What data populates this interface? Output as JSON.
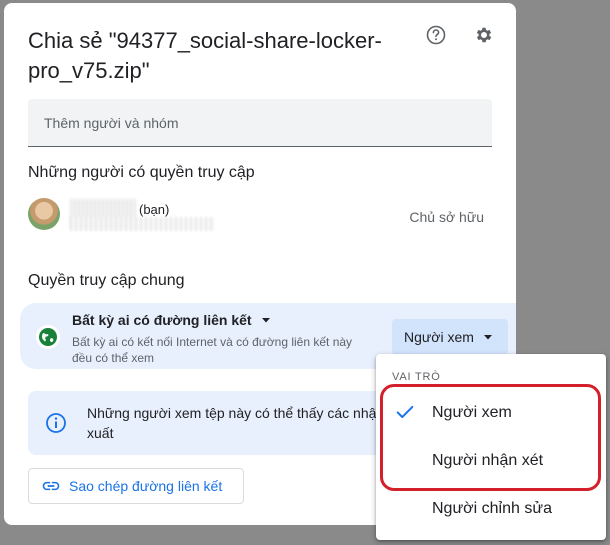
{
  "dialog": {
    "title": "Chia sẻ \"94377_social-share-locker-pro_v75.zip\"",
    "help_icon": "help-circle-icon",
    "settings_icon": "gear-icon"
  },
  "add_people": {
    "placeholder": "Thêm người và nhóm"
  },
  "people_section": {
    "title": "Những người có quyền truy cập",
    "person": {
      "you_label": "(bạn)",
      "role": "Chủ sở hữu"
    }
  },
  "general_access": {
    "title": "Quyền truy cập chung",
    "type_label": "Bất kỳ ai có đường liên kết",
    "description": "Bất kỳ ai có kết nối Internet và có đường liên kết này đều có thể xem",
    "role_button": "Người xem"
  },
  "info": {
    "text": "Những người xem tệp này có thể thấy các nhận xét và mục đề xuất"
  },
  "copy_link": {
    "label": "Sao chép đường liên kết"
  },
  "role_menu": {
    "header": "VAI TRÒ",
    "items": [
      {
        "label": "Người xem",
        "checked": true
      },
      {
        "label": "Người nhận xét",
        "checked": false
      },
      {
        "label": "Người chỉnh sửa",
        "checked": false
      }
    ]
  },
  "colors": {
    "accent": "#1a73e8",
    "highlight_outline": "#d3202a",
    "general_access_bg": "#e8f0fe",
    "globe": "#188038"
  }
}
